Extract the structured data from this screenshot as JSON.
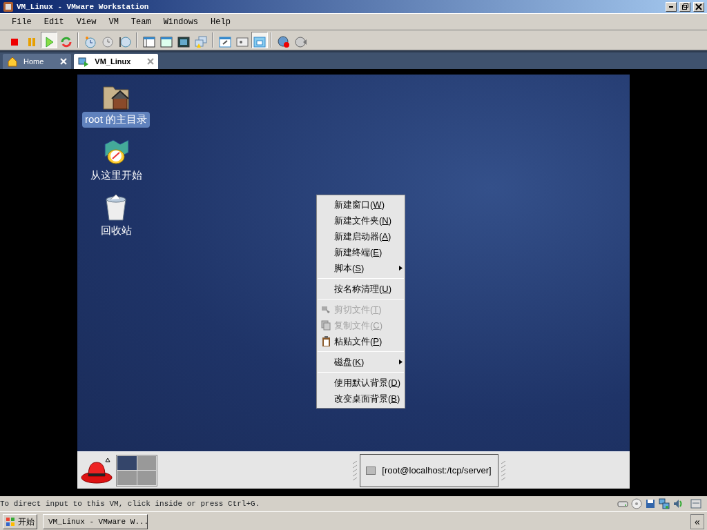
{
  "window": {
    "title": "VM_Linux - VMware Workstation"
  },
  "menu_bar": [
    "File",
    "Edit",
    "View",
    "VM",
    "Team",
    "Windows",
    "Help"
  ],
  "toolbar": [
    {
      "kind": "stop",
      "pressed": false
    },
    {
      "kind": "pause",
      "pressed": false
    },
    {
      "kind": "play",
      "pressed": true
    },
    {
      "kind": "reset",
      "pressed": false
    },
    {
      "kind": "separator"
    },
    {
      "kind": "snapshot",
      "pressed": false
    },
    {
      "kind": "revert",
      "pressed": false
    },
    {
      "kind": "manager",
      "pressed": false
    },
    {
      "kind": "separator"
    },
    {
      "kind": "sidebar",
      "pressed": false
    },
    {
      "kind": "quickswitch",
      "pressed": false
    },
    {
      "kind": "fullscreen",
      "pressed": false
    },
    {
      "kind": "unity",
      "pressed": false
    },
    {
      "kind": "separator"
    },
    {
      "kind": "settings",
      "pressed": false
    },
    {
      "kind": "console",
      "pressed": false
    },
    {
      "kind": "windowed",
      "pressed": true
    },
    {
      "kind": "separator"
    },
    {
      "kind": "record",
      "pressed": false
    },
    {
      "kind": "replay",
      "pressed": false
    }
  ],
  "tabs": [
    {
      "label": "Home",
      "selected": false
    },
    {
      "label": "VM_Linux",
      "selected": true
    }
  ],
  "desktop_icons": [
    {
      "label": "root 的主目录",
      "selected": true
    },
    {
      "label": "从这里开始",
      "selected": false
    },
    {
      "label": "回收站",
      "selected": false
    }
  ],
  "context_menu": [
    {
      "kind": "plain",
      "text": "新建窗口(W)",
      "disabled": false
    },
    {
      "kind": "plain",
      "text": "新建文件夹(N)",
      "disabled": false
    },
    {
      "kind": "plain",
      "text": "新建启动器(A)",
      "disabled": false
    },
    {
      "kind": "plain",
      "text": "新建终端(E)",
      "disabled": false
    },
    {
      "kind": "submenu",
      "text": "脚本(S)",
      "disabled": false
    },
    {
      "kind": "separator"
    },
    {
      "kind": "plain",
      "text": "按名称清理(U)",
      "disabled": false
    },
    {
      "kind": "separator"
    },
    {
      "kind": "with-icon",
      "text": "剪切文件(T)",
      "disabled": true
    },
    {
      "kind": "with-icon",
      "text": "复制文件(C)",
      "disabled": true
    },
    {
      "kind": "with-icon",
      "text": "粘贴文件(P)",
      "disabled": false
    },
    {
      "kind": "separator"
    },
    {
      "kind": "submenu",
      "text": "磁盘(K)",
      "disabled": false
    },
    {
      "kind": "separator"
    },
    {
      "kind": "plain",
      "text": "使用默认背景(D)",
      "disabled": false
    },
    {
      "kind": "plain",
      "text": "改变桌面背景(B)",
      "disabled": false
    }
  ],
  "guest_panel": {
    "workspaces": [
      {
        "selected": true
      },
      {
        "selected": false
      },
      {
        "selected": false
      },
      {
        "selected": false
      }
    ],
    "task_button": "[root@localhost:/tcp/server]"
  },
  "status_bar": {
    "message": "To direct input to this VM, click inside or press Ctrl+G."
  },
  "taskbar": {
    "start": "开始",
    "task": "VM_Linux - VMware W...",
    "collapse": "«"
  }
}
